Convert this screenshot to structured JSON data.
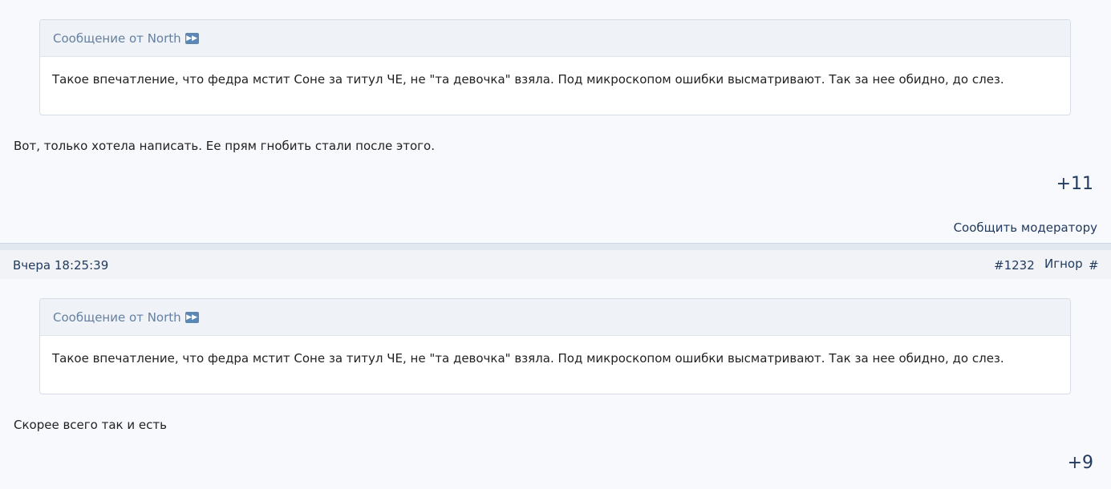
{
  "post1": {
    "quote": {
      "header_prefix": "Сообщение от",
      "author": "North",
      "icon": "jump-to-post-icon",
      "text": "Такое впечатление, что федра мстит Соне за титул ЧЕ, не \"та девочка\" взяла. Под микроскопом ошибки высматривают. Так за нее обидно, до слез."
    },
    "text": "Вот, только хотела написать.  Ее прям гнобить стали после этого.",
    "score": "+11",
    "report_label": "Сообщить модератору"
  },
  "post2": {
    "header": {
      "date": "Вчера 18:25:39",
      "number": "#1232",
      "ignore_label": "Игнор",
      "hash": "#"
    },
    "quote": {
      "header_prefix": "Сообщение от",
      "author": "North",
      "icon": "jump-to-post-icon",
      "text": "Такое впечатление, что федра мстит Соне за титул ЧЕ, не \"та девочка\" взяла. Под микроскопом ошибки высматривают. Так за нее обидно, до слез."
    },
    "text": "Скорее всего так и есть",
    "score": "+9"
  }
}
